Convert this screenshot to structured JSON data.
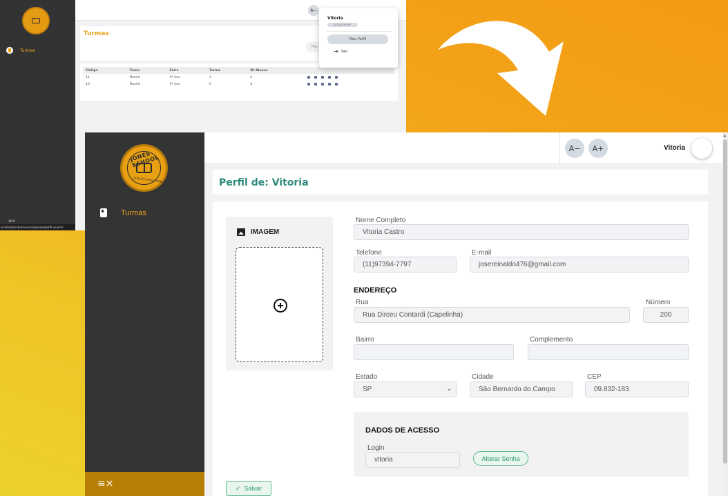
{
  "small": {
    "nav_label": "Turmas",
    "url": "localhost/sistema-escola/painel/perfil-usuario",
    "menu_icon": "≡×",
    "font_minus": "A−",
    "page_title": "Turmas",
    "search_placeholder": "Pes",
    "table": {
      "headers": [
        "Código",
        "Turno",
        "Série",
        "Turma",
        "Nº Alunos",
        ""
      ],
      "rows": [
        [
          "14",
          "Manhã",
          "4º Ano",
          "A",
          "0"
        ],
        [
          "16",
          "Manhã",
          "1º Ano",
          "E",
          "0"
        ]
      ]
    },
    "dropdown": {
      "name": "Vitoria",
      "badge": "D DUE DE REF",
      "profile_button": "Meu Perfil",
      "logout": "Sair"
    }
  },
  "main": {
    "nav_label": "Turmas",
    "logo_top": "JONES SCHOOL",
    "logo_bottom": "QUALITY EDUCATION",
    "menu_icon": "≡×",
    "font_minus": "A−",
    "font_plus": "A+",
    "user_name": "Vitoria",
    "page_title": "Perfil de: Vitoria",
    "image_label": "IMAGEM",
    "form": {
      "nome_label": "Nome Completo",
      "nome_value": "Vitoria Castro",
      "telefone_label": "Telefone",
      "telefone_value": "(11)97394-7797",
      "email_label": "E-mail",
      "email_value": "josereinaldo476@gmail.com",
      "endereco_title": "ENDEREÇO",
      "rua_label": "Rua",
      "rua_value": "Rua Dirceu Contardi (Capelinha)",
      "numero_label": "Número",
      "numero_value": "200",
      "bairro_label": "Bairro",
      "bairro_value": "",
      "complemento_label": "Complemento",
      "complemento_value": "",
      "estado_label": "Estado",
      "estado_value": "SP",
      "cidade_label": "Cidade",
      "cidade_value": "São Bernardo do Campo",
      "cep_label": "CEP",
      "cep_value": "09.832-183",
      "acesso_title": "DADOS DE ACESSO",
      "login_label": "Login",
      "login_value": "vitoria",
      "alterar_senha": "Alterar Senha",
      "salvar": "Salvar"
    }
  },
  "colors": {
    "accent_orange": "#f2a21a",
    "title_teal": "#2e8a7d",
    "success_green": "#2e9a66",
    "sidebar": "#343434"
  }
}
